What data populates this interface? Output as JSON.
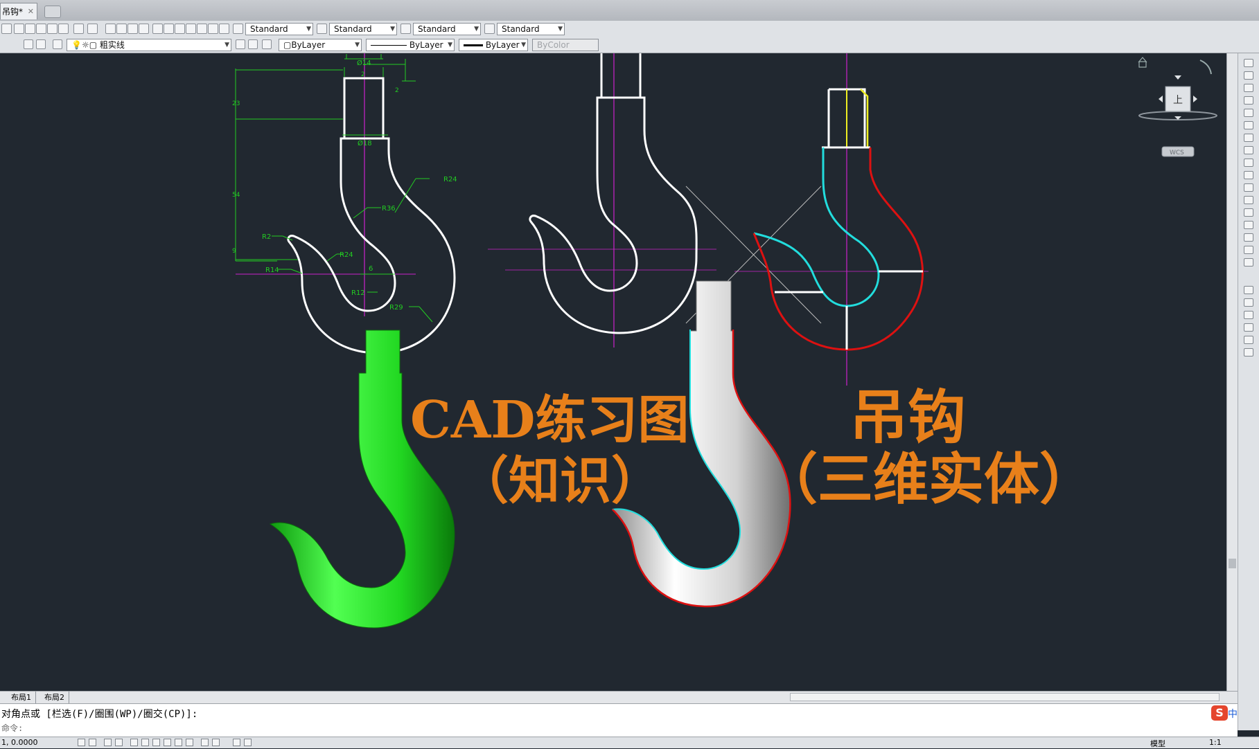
{
  "document_tab": {
    "title": "吊钩*",
    "close_icon": "close-icon"
  },
  "toolbar_styles": {
    "text_style": "Standard",
    "dim_style": "Standard",
    "table_style": "Standard",
    "multileader_style": "Standard"
  },
  "toolbar_layers": {
    "layer": "粗实线",
    "color": "ByLayer",
    "linetype": "ByLayer",
    "lineweight": "ByLayer",
    "plot_style": "ByColor"
  },
  "drawing": {
    "title_left": "CAD练习图",
    "subtitle_left": "（知识）",
    "title_right": "吊钩",
    "subtitle_right": "（三维实体）",
    "dimensions": {
      "d14": "Ø14",
      "d18": "Ø18",
      "two_a": "2",
      "two_b": "2",
      "h23": "23",
      "h54": "54",
      "h9": "9",
      "r24_top": "R24",
      "r36": "R36",
      "r2": "R2",
      "r24_inner": "R24",
      "r14": "R14",
      "six": "6",
      "r12": "R12",
      "r29": "R29"
    }
  },
  "viewcube": {
    "face": "上",
    "wcs": "WCS"
  },
  "layout_tabs": [
    "布局1",
    "布局2"
  ],
  "command_line": {
    "prompt": "对角点或 [栏选(F)/圈围(WP)/圈交(CP)]:",
    "input_hint": "命令:",
    "ime": "中"
  },
  "status_bar": {
    "coords": "1, 0.0000",
    "model": "模型",
    "scale": "1:1"
  },
  "colors": {
    "canvas": "#212830",
    "dimension": "#22cc22",
    "centerline": "#cc22cc",
    "outline": "#ffffff",
    "cyan": "#22dddd",
    "red": "#dd1111",
    "yellow": "#eeee22",
    "text_orange": "#e8801a"
  }
}
